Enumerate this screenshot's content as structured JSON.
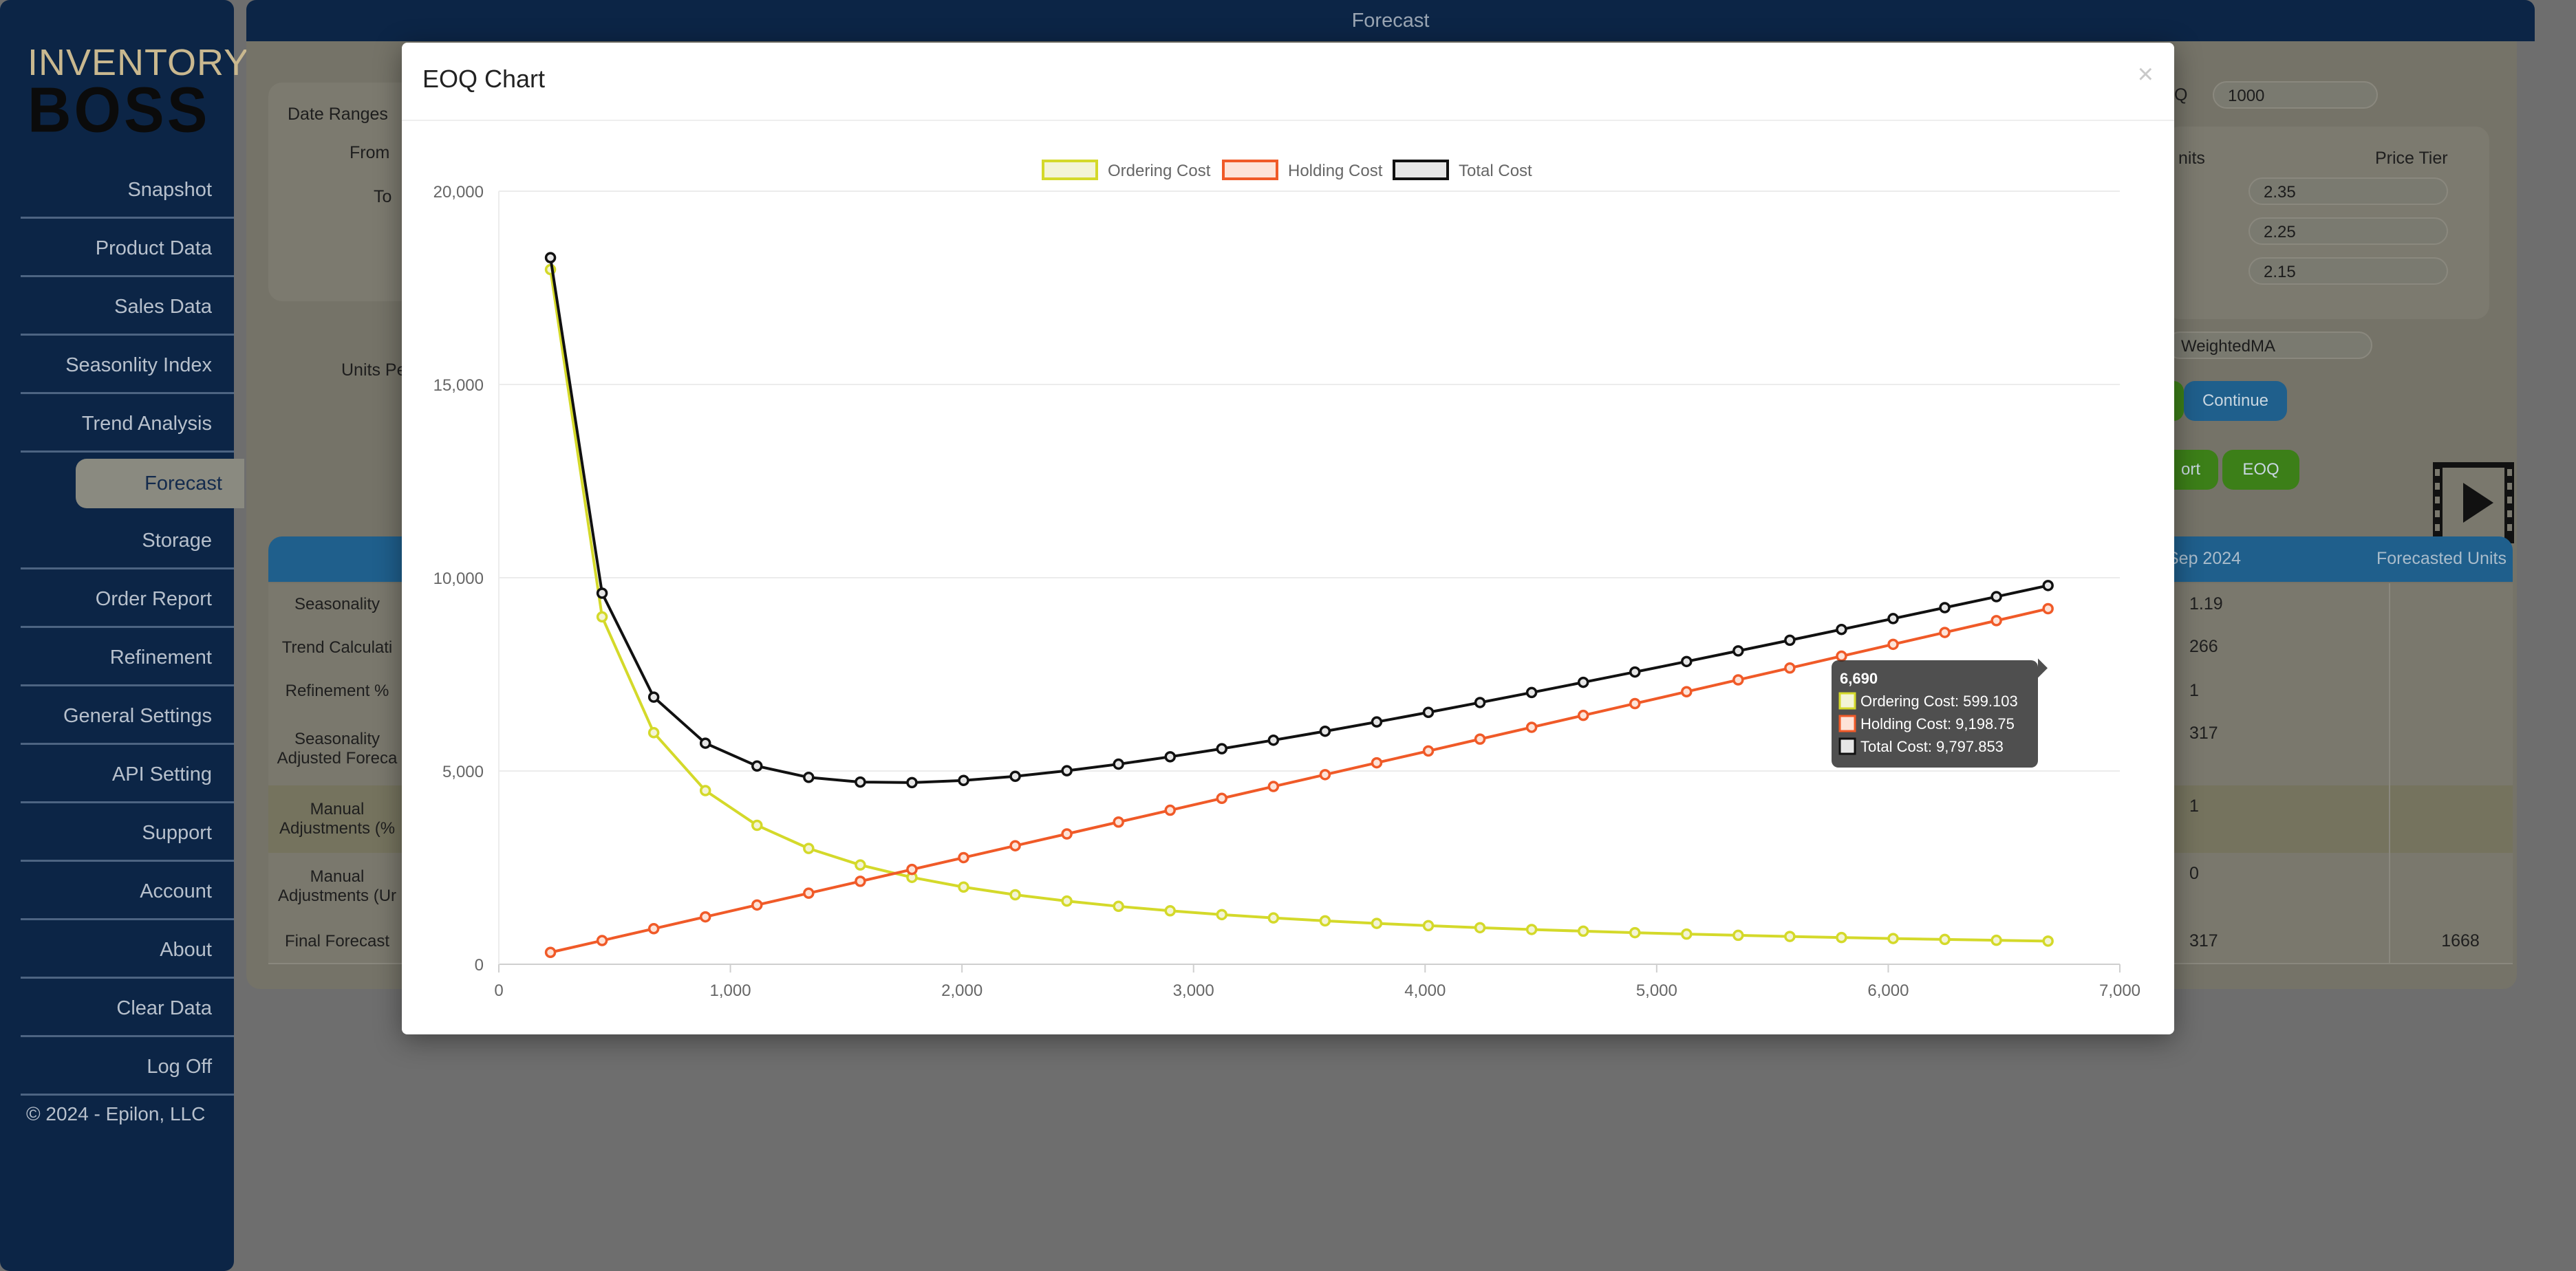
{
  "sidebar": {
    "logo_top": "INVENTORY",
    "logo_bottom": "BOSS",
    "items": [
      {
        "label": "Snapshot"
      },
      {
        "label": "Product Data"
      },
      {
        "label": "Sales Data"
      },
      {
        "label": "Seasonlity Index"
      },
      {
        "label": "Trend Analysis"
      },
      {
        "label": "Forecast"
      },
      {
        "label": "Storage"
      },
      {
        "label": "Order Report"
      },
      {
        "label": "Refinement"
      },
      {
        "label": "General Settings"
      },
      {
        "label": "API Setting"
      },
      {
        "label": "Support"
      },
      {
        "label": "Account"
      },
      {
        "label": "About"
      },
      {
        "label": "Clear Data"
      },
      {
        "label": "Log Off"
      }
    ],
    "active_item": "Forecast",
    "copyright": "© 2024 - Epilon, LLC"
  },
  "header": {
    "title": "Forecast"
  },
  "background": {
    "date_ranges_label": "Date Ranges",
    "from_label": "From",
    "to_label": "To",
    "units_per_label": "Units Pe",
    "eoq_suffix": "Q",
    "eoq_value": "1000",
    "units_col": "nits",
    "price_tier_col": "Price Tier",
    "price_tiers": [
      "2.35",
      "2.25",
      "2.15"
    ],
    "method_value": "WeightedMA",
    "continue_button": "Continue",
    "report_button": "ort",
    "eoq_button": "EOQ",
    "table_header_month": "Sep 2024",
    "table_header_forecast": "Forecasted Units",
    "rows": [
      {
        "label": "Seasonality",
        "month": "1.19",
        "forecast": ""
      },
      {
        "label": "Trend Calculati",
        "month": "266",
        "forecast": ""
      },
      {
        "label": "Refinement %",
        "month": "1",
        "forecast": ""
      },
      {
        "label": "Seasonality Adjusted Foreca",
        "month": "317",
        "forecast": ""
      },
      {
        "label": "Manual Adjustments (%",
        "month": "1",
        "forecast": ""
      },
      {
        "label": "Manual Adjustments (Ur",
        "month": "0",
        "forecast": ""
      },
      {
        "label": "Final Forecast",
        "month": "317",
        "forecast": "1668"
      }
    ]
  },
  "modal": {
    "title": "EOQ Chart",
    "close_glyph": "×"
  },
  "tooltip": {
    "title": "6,690",
    "lines": [
      "Ordering Cost: 599.103",
      "Holding Cost: 9,198.75",
      "Total Cost: 9,797.853"
    ]
  },
  "colors": {
    "ordering": "#d4d92a",
    "holding": "#f05a28",
    "total": "#111111",
    "sidebar_bg": "#0c2546",
    "continue_bg": "#1f5f8c",
    "eoq_bg": "#3c7f18"
  },
  "chart_data": {
    "type": "line",
    "title": "",
    "xlabel": "",
    "ylabel": "",
    "xlim": [
      0,
      7000
    ],
    "ylim": [
      0,
      20000
    ],
    "x_ticks": [
      "0",
      "1,000",
      "2,000",
      "3,000",
      "4,000",
      "5,000",
      "6,000",
      "7,000"
    ],
    "y_ticks": [
      "0",
      "5,000",
      "10,000",
      "15,000",
      "20,000"
    ],
    "legend_position": "top",
    "x": [
      223,
      446,
      669,
      892,
      1115,
      1338,
      1561,
      1784,
      2007,
      2230,
      2453,
      2676,
      2899,
      3122,
      3345,
      3568,
      3791,
      4014,
      4237,
      4460,
      4683,
      4906,
      5129,
      5352,
      5575,
      5798,
      6021,
      6244,
      6467,
      6690
    ],
    "series": [
      {
        "name": "Ordering Cost",
        "values": [
          17973,
          8987,
          5991,
          4493,
          3595,
          2996,
          2568,
          2247,
          1997,
          1797,
          1634,
          1498,
          1383,
          1284,
          1198,
          1123,
          1057,
          999,
          946,
          899,
          856,
          817,
          781,
          749,
          719,
          691,
          666,
          642,
          620,
          599
        ]
      },
      {
        "name": "Holding Cost",
        "values": [
          307,
          613,
          920,
          1226,
          1533,
          1839,
          2146,
          2453,
          2759,
          3066,
          3372,
          3679,
          3985,
          4292,
          4599,
          4905,
          5212,
          5518,
          5825,
          6131,
          6438,
          6744,
          7051,
          7358,
          7664,
          7971,
          8277,
          8584,
          8890,
          9199
        ]
      },
      {
        "name": "Total Cost",
        "values": [
          18280,
          9600,
          6911,
          5719,
          5128,
          4835,
          4714,
          4700,
          4756,
          4863,
          5006,
          5177,
          5368,
          5576,
          5797,
          6028,
          6269,
          6517,
          6771,
          7030,
          7294,
          7561,
          7832,
          8107,
          8383,
          8662,
          8943,
          9226,
          9510,
          9798
        ]
      }
    ]
  }
}
